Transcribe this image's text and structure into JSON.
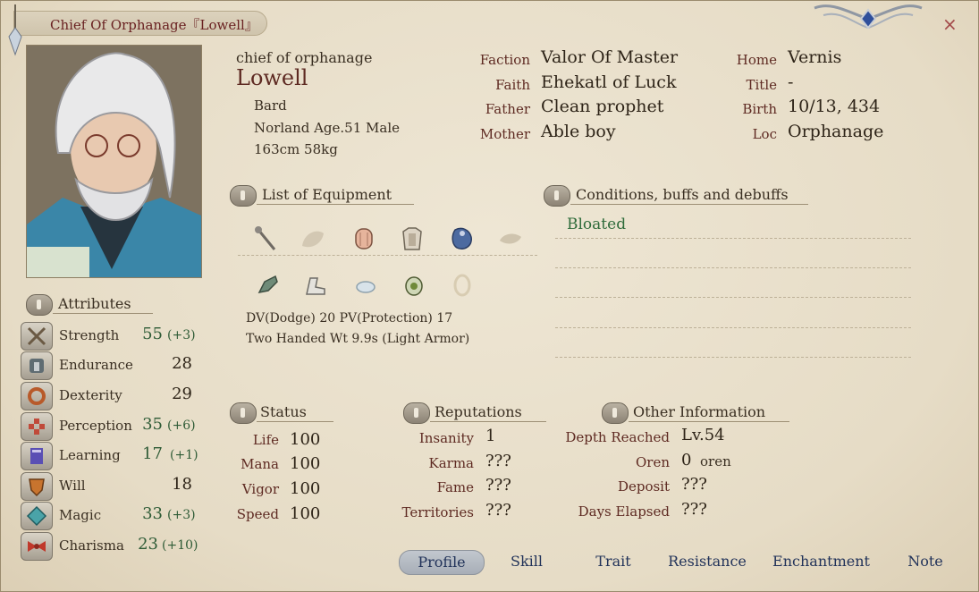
{
  "window": {
    "title": "Chief Of Orphanage『Lowell』",
    "close_glyph": "×"
  },
  "profile": {
    "alias": "chief of orphanage",
    "name": "Lowell",
    "class": "Bard",
    "race_age_sex": "Norland Age.51 Male",
    "height_weight": "163cm 58kg"
  },
  "info_mid": [
    {
      "label": "Faction",
      "value": "Valor Of Master"
    },
    {
      "label": "Faith",
      "value": "Ehekatl of Luck"
    },
    {
      "label": "Father",
      "value": "Clean prophet"
    },
    {
      "label": "Mother",
      "value": "Able boy"
    }
  ],
  "info_right": [
    {
      "label": "Home",
      "value": "Vernis"
    },
    {
      "label": "Title",
      "value": "-"
    },
    {
      "label": "Birth",
      "value": "10/13, 434"
    },
    {
      "label": "Loc",
      "value": "Orphanage"
    }
  ],
  "attributes": {
    "heading": "Attributes",
    "items": [
      {
        "name": "Strength",
        "value": "55",
        "bonus": "(+3)",
        "icon": "swords-icon"
      },
      {
        "name": "Endurance",
        "value": "28",
        "bonus": "",
        "icon": "armor-icon"
      },
      {
        "name": "Dexterity",
        "value": "29",
        "bonus": "",
        "icon": "ring-icon"
      },
      {
        "name": "Perception",
        "value": "35",
        "bonus": "(+6)",
        "icon": "eye-icon"
      },
      {
        "name": "Learning",
        "value": "17",
        "bonus": "(+1)",
        "icon": "book-icon"
      },
      {
        "name": "Will",
        "value": "18",
        "bonus": "",
        "icon": "shield-icon"
      },
      {
        "name": "Magic",
        "value": "33",
        "bonus": "(+3)",
        "icon": "crystal-icon"
      },
      {
        "name": "Charisma",
        "value": "23",
        "bonus": "(+10)",
        "icon": "ribbon-icon"
      }
    ]
  },
  "equipment": {
    "heading": "List of Equipment",
    "dv_pv": "DV(Dodge) 20   PV(Protection) 17",
    "style": "Two Handed Wt 9.9s (Light Armor)",
    "slots_row1": [
      "staff-icon",
      "empty-slot-icon",
      "helmet-icon",
      "body-armor-icon",
      "cloak-icon",
      "empty-slot-icon"
    ],
    "slots_row2": [
      "gloves-icon",
      "boots-icon",
      "amulet-icon",
      "pouch-icon",
      "ring-slot-icon"
    ]
  },
  "conditions": {
    "heading": "Conditions, buffs and debuffs",
    "items": [
      "Bloated"
    ]
  },
  "status": {
    "heading": "Status",
    "rows": [
      {
        "label": "Life",
        "value": "100"
      },
      {
        "label": "Mana",
        "value": "100"
      },
      {
        "label": "Vigor",
        "value": "100"
      },
      {
        "label": "Speed",
        "value": "100"
      }
    ]
  },
  "reputations": {
    "heading": "Reputations",
    "rows": [
      {
        "label": "Insanity",
        "value": "1"
      },
      {
        "label": "Karma",
        "value": "???"
      },
      {
        "label": "Fame",
        "value": "???"
      },
      {
        "label": "Territories",
        "value": "???"
      }
    ]
  },
  "other": {
    "heading": "Other Information",
    "rows": [
      {
        "label": "Depth Reached",
        "value": "Lv.54"
      },
      {
        "label": "Oren",
        "value": "0",
        "unit": "oren"
      },
      {
        "label": "Deposit",
        "value": "???"
      },
      {
        "label": "Days Elapsed",
        "value": "???"
      }
    ]
  },
  "tabs": [
    "Profile",
    "Skill",
    "Trait",
    "Resistance",
    "Enchantment",
    "Note"
  ],
  "active_tab": "Profile",
  "colors": {
    "accent_green": "#2e5b36",
    "label_red": "#5e2a22",
    "tab_blue": "#22335a"
  }
}
